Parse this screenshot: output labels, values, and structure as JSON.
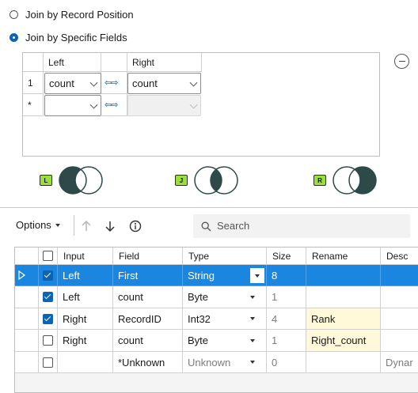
{
  "join_options": {
    "by_position_label": "Join by Record Position",
    "by_fields_label": "Join by Specific Fields"
  },
  "join_grid": {
    "headers": {
      "left": "Left",
      "right": "Right"
    },
    "rows": [
      {
        "num": "1",
        "left": "count",
        "right": "count"
      },
      {
        "num": "*",
        "left": "",
        "right": ""
      }
    ]
  },
  "anchors": {
    "left": "L",
    "join": "J",
    "right": "R"
  },
  "toolbar": {
    "options_label": "Options",
    "search_placeholder": "Search"
  },
  "fields_table": {
    "headers": [
      "Input",
      "Field",
      "Type",
      "Size",
      "Rename",
      "Desc"
    ],
    "rows": [
      {
        "checked": true,
        "input": "Left",
        "field": "First",
        "type": "String",
        "size": "8",
        "rename": "",
        "desc": "",
        "selected": true
      },
      {
        "checked": true,
        "input": "Left",
        "field": "count",
        "type": "Byte",
        "size": "1",
        "rename": "",
        "desc": ""
      },
      {
        "checked": true,
        "input": "Right",
        "field": "RecordID",
        "type": "Int32",
        "size": "4",
        "rename": "Rank",
        "desc": ""
      },
      {
        "checked": false,
        "input": "Right",
        "field": "count",
        "type": "Byte",
        "size": "1",
        "rename": "Right_count",
        "desc": ""
      },
      {
        "checked": false,
        "input": "",
        "field": "*Unknown",
        "type": "Unknown",
        "size": "0",
        "rename": "",
        "desc": "Dynar"
      }
    ]
  },
  "colors": {
    "accent": "#0a63b6",
    "selection": "#1a86df",
    "anchor_green": "#9be03a",
    "venn_fill": "#2d4a49",
    "rename_highlight": "#fff8d9"
  }
}
